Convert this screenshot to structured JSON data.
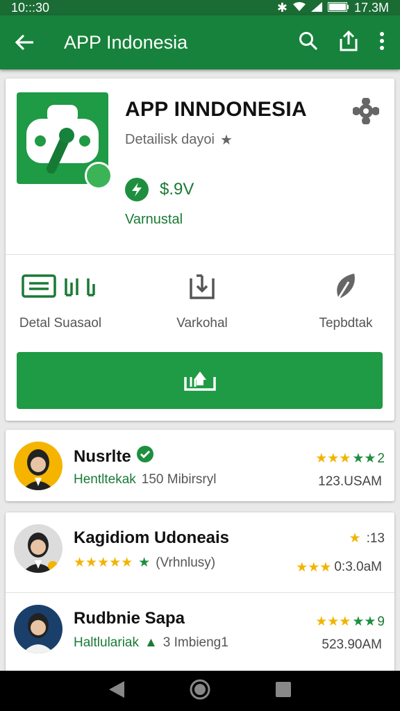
{
  "status": {
    "time": "10:::30",
    "battery": "17.3M"
  },
  "appbar": {
    "title": "APP Indonesia"
  },
  "app": {
    "name": "APP INNDONESIA",
    "subtitle": "Detailisk dayoi",
    "price": "$.9V",
    "variant": "Varnustal"
  },
  "features": [
    {
      "label": "Detal Suasaol",
      "icon": "chat-bars-icon"
    },
    {
      "label": "Varkohal",
      "icon": "download-box-icon"
    },
    {
      "label": "Tepbdtak",
      "icon": "leaf-icon"
    }
  ],
  "colors": {
    "primary": "#17823b",
    "accent": "#1f9a45",
    "star": "#f2b400"
  },
  "reviews": [
    {
      "name": "Nusrlte",
      "meta_green": "Hentltekak",
      "meta": "150 Mibirsryl",
      "rating_text": "2",
      "time": "123.USAM"
    },
    {
      "name": "Kagidiom Udoneais",
      "meta": "(Vrhnlusy)",
      "rating_text": ":13",
      "time": "0:3.0aM"
    },
    {
      "name": "Rudbnie Sapa",
      "meta_green": "Haltlulariak",
      "meta": "3 Imbieng1",
      "rating_text": "9",
      "time": "523.90AM"
    }
  ]
}
